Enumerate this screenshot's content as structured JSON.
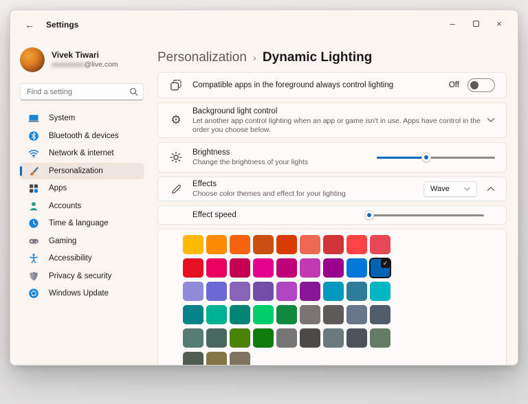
{
  "window": {
    "title": "Settings"
  },
  "titlebar": {
    "back_glyph": "←",
    "minimize_glyph": "–",
    "close_glyph": "×"
  },
  "user": {
    "name": "Vivek Tiwari",
    "email_redacted": "xxxxxxxxxx",
    "email_suffix": "@live.com"
  },
  "search": {
    "placeholder": "Find a setting"
  },
  "sidebar": {
    "items": [
      {
        "label": "System"
      },
      {
        "label": "Bluetooth & devices"
      },
      {
        "label": "Network & internet"
      },
      {
        "label": "Personalization"
      },
      {
        "label": "Apps"
      },
      {
        "label": "Accounts"
      },
      {
        "label": "Time & language"
      },
      {
        "label": "Gaming"
      },
      {
        "label": "Accessibility"
      },
      {
        "label": "Privacy & security"
      },
      {
        "label": "Windows Update"
      }
    ],
    "selected": "Personalization"
  },
  "breadcrumb": {
    "parent": "Personalization",
    "separator": "›",
    "current": "Dynamic Lighting"
  },
  "settings": {
    "foreground_control": {
      "label": "Compatible apps in the foreground always control lighting",
      "toggle_label": "Off",
      "toggle_on": false
    },
    "background_control": {
      "title": "Background light control",
      "description": "Let another app control lighting when an app or game isn't in use. Apps have control in the order you choose below."
    },
    "brightness": {
      "title": "Brightness",
      "description": "Change the brightness of your lights",
      "value_percent": 42
    },
    "effects": {
      "title": "Effects",
      "description": "Choose color themes and effect for your lighting",
      "selected_effect": "Wave",
      "expanded": true
    },
    "effect_speed": {
      "label": "Effect speed",
      "value_percent": 2
    }
  },
  "palette": {
    "selected_index": 17,
    "colors": [
      "#FFB900",
      "#FF8C00",
      "#F7630C",
      "#CA5010",
      "#DA3B01",
      "#EF6950",
      "#D13438",
      "#FF4343",
      "#E74856",
      "#E81123",
      "#EA005E",
      "#C30052",
      "#E3008C",
      "#BF0077",
      "#C239B3",
      "#9A0089",
      "#0078D7",
      "#0063B1",
      "#8E8CD8",
      "#6B69D6",
      "#8764B8",
      "#744DA9",
      "#B146C2",
      "#881798",
      "#0099BC",
      "#2D7D9A",
      "#00B7C3",
      "#038387",
      "#00B294",
      "#018574",
      "#00CC6A",
      "#10893E",
      "#7A7574",
      "#5D5A58",
      "#68768A",
      "#515C6B",
      "#567C73",
      "#486860",
      "#498205",
      "#107C10",
      "#767676",
      "#4C4A48",
      "#69797E",
      "#4A5459",
      "#647C64",
      "#525E54",
      "#847545",
      "#7E735F"
    ]
  },
  "theme": {
    "accent": "#0F67C0",
    "selection_check": "✓"
  }
}
